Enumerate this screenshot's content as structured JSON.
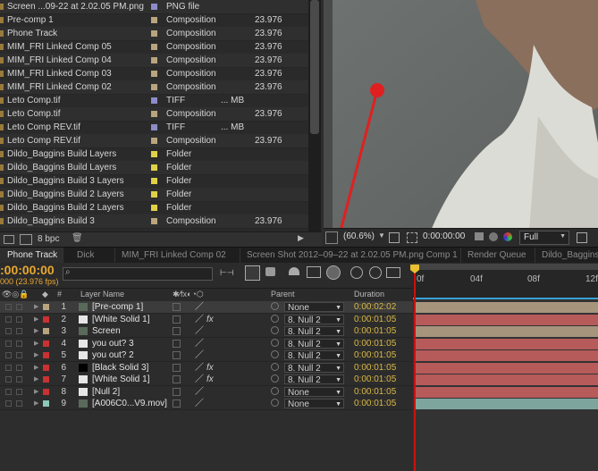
{
  "project": {
    "rows": [
      {
        "name": "Screen ...09-22 at 2.02.05 PM.png",
        "type": "PNG file",
        "size": "",
        "fps": "",
        "swatch": "#8c8cc8"
      },
      {
        "name": "Pre-comp 1",
        "type": "Composition",
        "size": "",
        "fps": "23.976",
        "swatch": "#b9a57d"
      },
      {
        "name": "Phone Track",
        "type": "Composition",
        "size": "",
        "fps": "23.976",
        "swatch": "#b9a57d"
      },
      {
        "name": "MIM_FRI Linked Comp 05",
        "type": "Composition",
        "size": "",
        "fps": "23.976",
        "swatch": "#b9a57d"
      },
      {
        "name": "MIM_FRI Linked Comp 04",
        "type": "Composition",
        "size": "",
        "fps": "23.976",
        "swatch": "#b9a57d"
      },
      {
        "name": "MIM_FRI Linked Comp 03",
        "type": "Composition",
        "size": "",
        "fps": "23.976",
        "swatch": "#b9a57d"
      },
      {
        "name": "MIM_FRI Linked Comp 02",
        "type": "Composition",
        "size": "",
        "fps": "23.976",
        "swatch": "#b9a57d"
      },
      {
        "name": "Leto Comp.tif",
        "type": "TIFF",
        "size": "... MB",
        "fps": "",
        "swatch": "#8c8cc8"
      },
      {
        "name": "Leto Comp.tif",
        "type": "Composition",
        "size": "",
        "fps": "23.976",
        "swatch": "#b9a57d"
      },
      {
        "name": "Leto Comp REV.tif",
        "type": "TIFF",
        "size": "... MB",
        "fps": "",
        "swatch": "#8c8cc8"
      },
      {
        "name": "Leto Comp REV.tif",
        "type": "Composition",
        "size": "",
        "fps": "23.976",
        "swatch": "#b9a57d"
      },
      {
        "name": "Dildo_Baggins Build Layers",
        "type": "Folder",
        "size": "",
        "fps": "",
        "swatch": "#e0d048"
      },
      {
        "name": "Dildo_Baggins Build Layers",
        "type": "Folder",
        "size": "",
        "fps": "",
        "swatch": "#e0d048"
      },
      {
        "name": "Dildo_Baggins Build 3 Layers",
        "type": "Folder",
        "size": "",
        "fps": "",
        "swatch": "#e0d048"
      },
      {
        "name": "Dildo_Baggins Build 2 Layers",
        "type": "Folder",
        "size": "",
        "fps": "",
        "swatch": "#e0d048"
      },
      {
        "name": "Dildo_Baggins Build 2 Layers",
        "type": "Folder",
        "size": "",
        "fps": "",
        "swatch": "#e0d048"
      },
      {
        "name": "Dildo_Baggins Build 3",
        "type": "Composition",
        "size": "",
        "fps": "23.976",
        "swatch": "#b9a57d"
      }
    ],
    "bpc": "8 bpc"
  },
  "viewer": {
    "zoom": "(60.6%)",
    "timecode": "0:00:00:00",
    "resolution": "Full"
  },
  "tabs": [
    {
      "label": "Phone Track",
      "active": true
    },
    {
      "label": "Dick",
      "active": false
    },
    {
      "label": "MIM_FRI Linked Comp 02",
      "active": false
    },
    {
      "label": "Screen Shot 2012–09–22 at 2.02.05 PM.png Comp 1",
      "active": false
    },
    {
      "label": "Render Queue",
      "active": false
    },
    {
      "label": "Dildo_Baggins",
      "active": false
    }
  ],
  "timeline": {
    "timecode": ":00:00:00",
    "fps": "000 (23.976 fps)",
    "search_placeholder": "",
    "ruler_labels": [
      "0f",
      "04f",
      "08f",
      "12f"
    ],
    "columns": {
      "hash": "#",
      "layer_name": "Layer Name",
      "parent": "Parent",
      "duration": "Duration"
    },
    "layers": [
      {
        "num": "1",
        "name": "[Pre-comp 1]",
        "label": "#b9a57d",
        "parent": "None",
        "duration": "0:00:02:02",
        "selected": true,
        "bar": "#a7947d",
        "fx": false
      },
      {
        "num": "2",
        "name": "[White Solid 1]",
        "label": "#c83232",
        "parent": "8. Null 2",
        "duration": "0:00:01:05",
        "selected": false,
        "bar": "#b65a5a",
        "fx": true
      },
      {
        "num": "3",
        "name": "Screen",
        "label": "#b9a57d",
        "parent": "8. Null 2",
        "duration": "0:00:01:05",
        "selected": false,
        "bar": "#a7947d",
        "fx": false
      },
      {
        "num": "4",
        "name": "you out? 3",
        "label": "#c83232",
        "parent": "8. Null 2",
        "duration": "0:00:01:05",
        "selected": false,
        "bar": "#b65a5a",
        "fx": false
      },
      {
        "num": "5",
        "name": "you out? 2",
        "label": "#c83232",
        "parent": "8. Null 2",
        "duration": "0:00:01:05",
        "selected": false,
        "bar": "#b65a5a",
        "fx": false
      },
      {
        "num": "6",
        "name": "[Black Solid 3]",
        "label": "#c83232",
        "parent": "8. Null 2",
        "duration": "0:00:01:05",
        "selected": false,
        "bar": "#b65a5a",
        "fx": true
      },
      {
        "num": "7",
        "name": "[White Solid 1]",
        "label": "#c83232",
        "parent": "8. Null 2",
        "duration": "0:00:01:05",
        "selected": false,
        "bar": "#b65a5a",
        "fx": true
      },
      {
        "num": "8",
        "name": "[Null 2]",
        "label": "#c83232",
        "parent": "None",
        "duration": "0:00:01:05",
        "selected": false,
        "bar": "#b65a5a",
        "fx": false
      },
      {
        "num": "9",
        "name": "[A006C0...V9.mov]",
        "label": "#8cc8b9",
        "parent": "None",
        "duration": "0:00:01:05",
        "selected": false,
        "bar": "#7ea59d",
        "fx": false
      }
    ]
  }
}
